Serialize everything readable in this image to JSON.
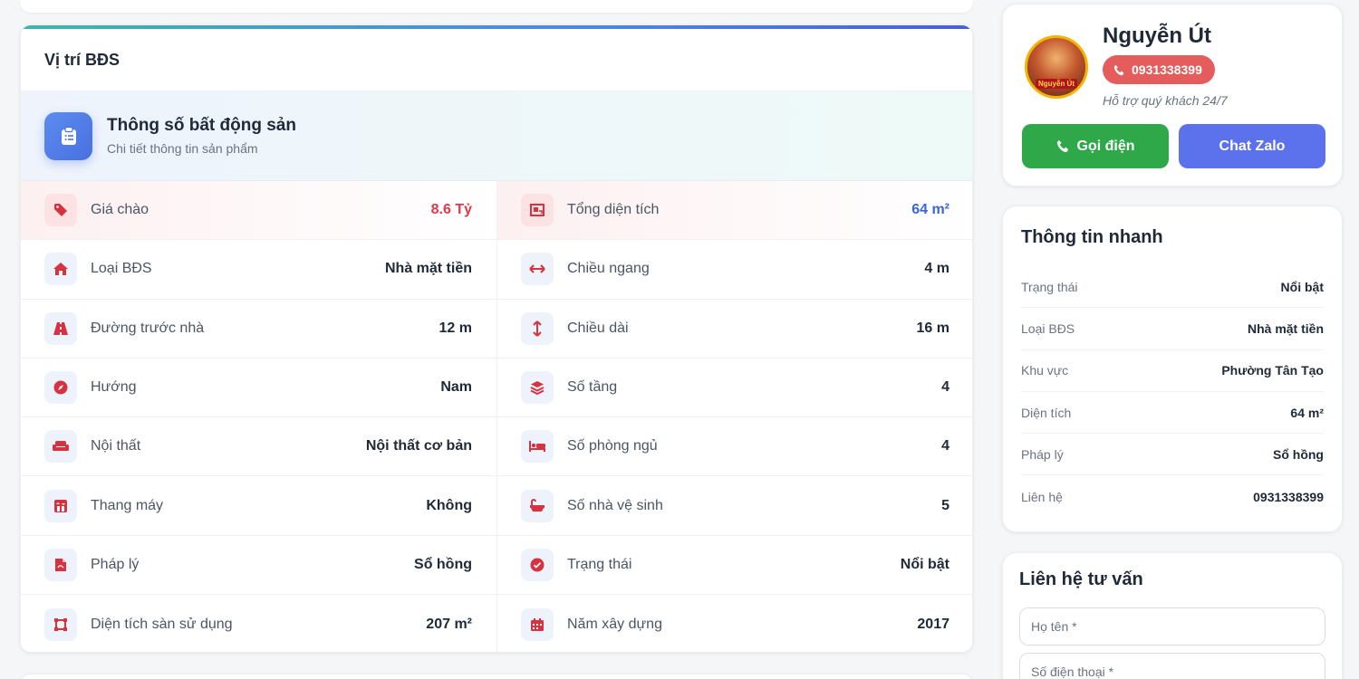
{
  "main": {
    "section_title": "Vị trí BĐS",
    "spec_title": "Thông số bất động sản",
    "spec_subtitle": "Chi tiết thông tin sản phẩm",
    "specs": [
      {
        "label": "Giá chào",
        "value": "8.6 Tỷ",
        "icon": "price-tag-icon"
      },
      {
        "label": "Tổng diện tích",
        "value": "64 m²",
        "icon": "area-icon"
      },
      {
        "label": "Loại BĐS",
        "value": "Nhà mặt tiền",
        "icon": "home-icon"
      },
      {
        "label": "Chiều ngang",
        "value": "4 m",
        "icon": "width-arrows-icon"
      },
      {
        "label": "Đường trước nhà",
        "value": "12 m",
        "icon": "road-icon"
      },
      {
        "label": "Chiều dài",
        "value": "16 m",
        "icon": "length-arrows-icon"
      },
      {
        "label": "Hướng",
        "value": "Nam",
        "icon": "compass-icon"
      },
      {
        "label": "Số tầng",
        "value": "4",
        "icon": "layers-icon"
      },
      {
        "label": "Nội thất",
        "value": "Nội thất cơ bản",
        "icon": "sofa-icon"
      },
      {
        "label": "Số phòng ngủ",
        "value": "4",
        "icon": "bed-icon"
      },
      {
        "label": "Thang máy",
        "value": "Không",
        "icon": "elevator-icon"
      },
      {
        "label": "Số nhà vệ sinh",
        "value": "5",
        "icon": "bath-icon"
      },
      {
        "label": "Pháp lý",
        "value": "Sổ hồng",
        "icon": "document-icon"
      },
      {
        "label": "Trạng thái",
        "value": "Nổi bật",
        "icon": "check-circle-icon"
      },
      {
        "label": "Diện tích sàn sử dụng",
        "value": "207 m²",
        "icon": "floor-area-icon"
      },
      {
        "label": "Năm xây dựng",
        "value": "2017",
        "icon": "calendar-icon"
      }
    ]
  },
  "agent": {
    "name": "Nguyễn Út",
    "phone": "0931338399",
    "support": "Hỗ trợ quý khách 24/7",
    "avatar_tag": "Nguyễn Út",
    "call_label": "Gọi điện",
    "zalo_label": "Chat Zalo"
  },
  "quick_info": {
    "title": "Thông tin nhanh",
    "rows": [
      {
        "label": "Trạng thái",
        "value": "Nổi bật"
      },
      {
        "label": "Loại BĐS",
        "value": "Nhà mặt tiền"
      },
      {
        "label": "Khu vực",
        "value": "Phường Tân Tạo"
      },
      {
        "label": "Diện tích",
        "value": "64 m²"
      },
      {
        "label": "Pháp lý",
        "value": "Sổ hồng"
      },
      {
        "label": "Liên hệ",
        "value": "0931338399"
      }
    ]
  },
  "contact": {
    "title": "Liên hệ tư vấn",
    "name_placeholder": "Họ tên *",
    "phone_placeholder": "Số điện thoại *"
  },
  "colors": {
    "accent_red": "#e03a4a",
    "accent_blue": "#3b64d8",
    "call_green": "#2fa84a",
    "zalo_blue": "#5b72ec",
    "icon_red": "#d6323f"
  }
}
